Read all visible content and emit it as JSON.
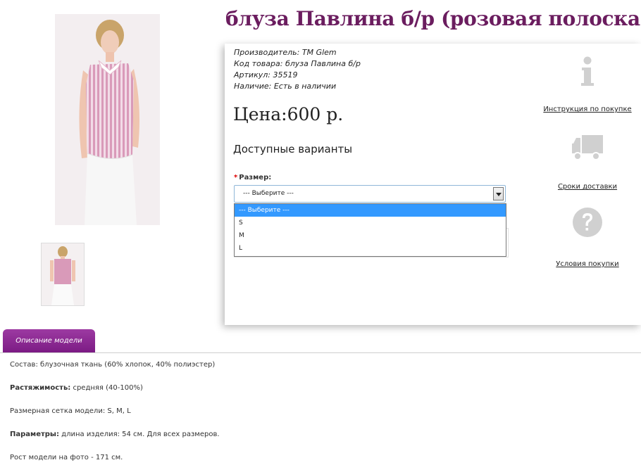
{
  "product": {
    "title": "блуза Павлина б/р (розовая полоска)",
    "manufacturer_label": "Производитель:",
    "manufacturer_value": "ТМ Glem",
    "code_label": "Код товара:",
    "code_value": "блуза Павлина б/р",
    "sku_label": "Артикул:",
    "sku_value": "35519",
    "stock_label": "Наличие:",
    "stock_value": "Есть в наличии",
    "price": "Цена:600 р.",
    "variants_title": "Доступные варианты"
  },
  "options": {
    "required_mark": "*",
    "size_label": "Размер:",
    "selected": "--- Выберите ---",
    "list": [
      "--- Выберите ---",
      "S",
      "M",
      "L"
    ]
  },
  "sidebar": {
    "instruction_link": "Инструкция по покупке",
    "delivery_link": "Сроки доставки",
    "terms_link": "Условия покупки"
  },
  "tabs": {
    "description": "Описание модели"
  },
  "description": {
    "composition_label": "Состав:",
    "composition_value": " блузочная ткань (60% хлопок, 40% полиэстер)",
    "stretch_label": "Растяжимость:",
    "stretch_value": " средняя (40-100%)",
    "sizes_label": "Размерная сетка модели:",
    "sizes_value": " S, M, L",
    "params_label": "Параметры:",
    "params_value": " длина изделия: 54 см. Для всех размеров.",
    "height_text": "Рост модели на фото - 171 см."
  },
  "colors": {
    "title": "#6b1d5f",
    "tab": "#8a2a91",
    "selected_option": "#3399ff",
    "icon_grey": "#d0d0d0"
  },
  "icons": {
    "instruction": "info-icon",
    "delivery": "truck-icon",
    "terms": "question-icon"
  }
}
